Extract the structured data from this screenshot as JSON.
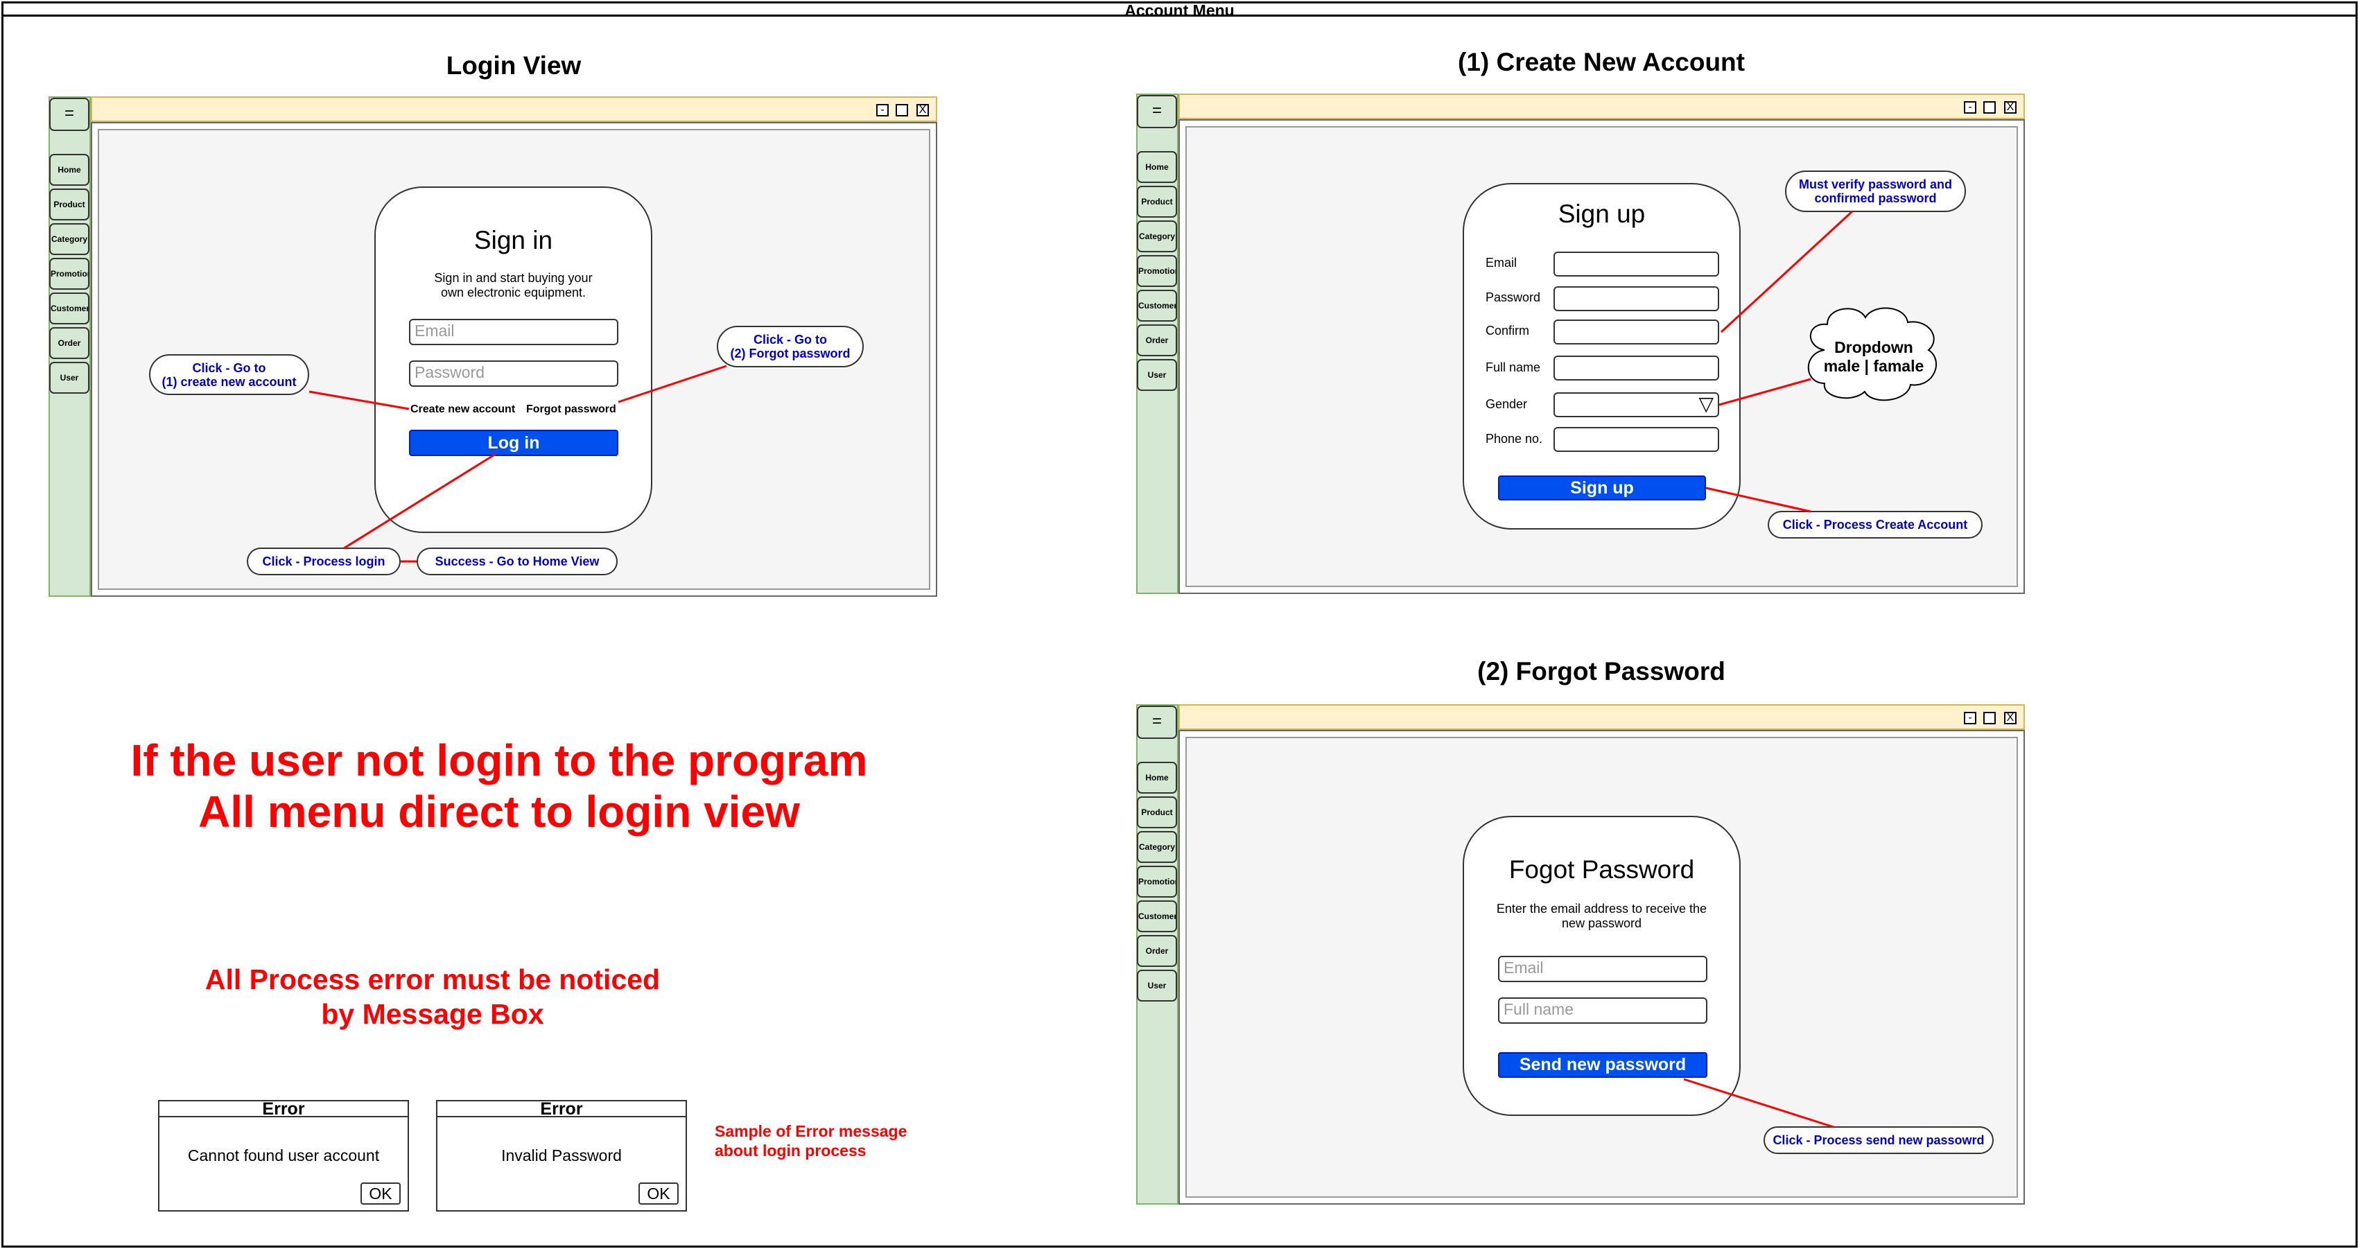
{
  "header": {
    "title": "Account Menu"
  },
  "views": {
    "login": {
      "title": "Login View"
    },
    "create": {
      "title": "(1) Create New Account"
    },
    "forgot": {
      "title": "(2) Forgot Password"
    }
  },
  "window": {
    "menu_icon": "=",
    "minimize": "-",
    "close": "X",
    "nav": [
      "Home",
      "Product",
      "Category",
      "Promotion",
      "Customer",
      "Order",
      "User"
    ]
  },
  "login": {
    "title": "Sign in",
    "subtitle": "Sign in and start buying your own electronic equipment.",
    "email_placeholder": "Email",
    "password_placeholder": "Password",
    "create_link": "Create new account",
    "forgot_link": "Forgot password",
    "button": "Log in",
    "callout_create": "Click - Go to\n(1) create new account",
    "callout_forgot": "Click - Go to\n(2) Forgot password",
    "callout_process": "Click - Process login",
    "callout_success": "Success - Go to Home View"
  },
  "signup": {
    "title": "Sign up",
    "labels": [
      "Email",
      "Password",
      "Confirm",
      "Full name",
      "Gender",
      "Phone no."
    ],
    "dropdown_icon": "▽",
    "button": "Sign up",
    "callout_verify": "Must verify password and confirmed password",
    "callout_dropdown": "Dropdown\nmale | famale",
    "callout_process": "Click - Process Create Account"
  },
  "forgot": {
    "title": "Fogot Password",
    "subtitle": "Enter the email address to receive the new password",
    "email_placeholder": "Email",
    "fullname_placeholder": "Full name",
    "button": "Send new password",
    "callout_process": "Click - Process send new passowrd"
  },
  "notes": {
    "redirect": "If the user not login to the program\nAll menu direct to login view",
    "errors": "All Process error must be noticed\nby Message Box",
    "sample": "Sample of Error message\nabout login process"
  },
  "messages": [
    {
      "title": "Error",
      "body": "Cannot found user account",
      "ok": "OK"
    },
    {
      "title": "Error",
      "body": "Invalid Password",
      "ok": "OK"
    }
  ],
  "colors": {
    "primary": "#0050ef",
    "connector": "#ff0000",
    "callout_text": "#0000cc",
    "titlebar": "#fff2cc",
    "sidebar": "#d5e8d4"
  }
}
